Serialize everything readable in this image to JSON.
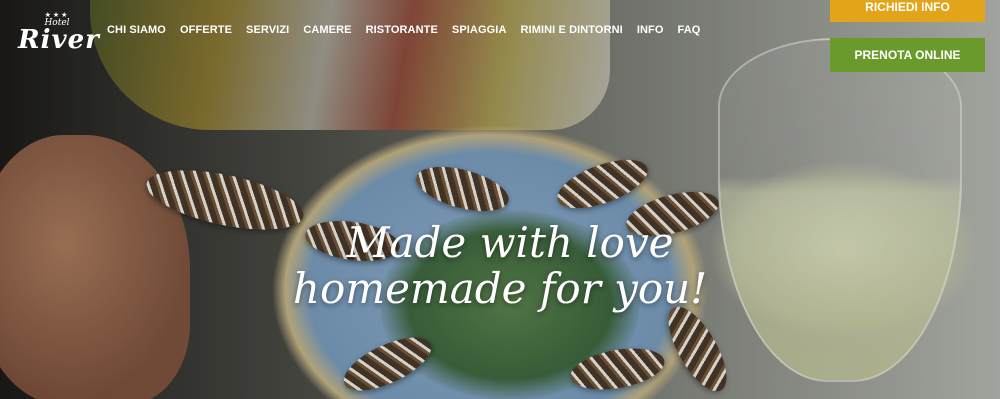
{
  "logo": {
    "stars": "★★★",
    "hotel": "Hotel",
    "name": "River"
  },
  "nav": {
    "items": [
      {
        "label": "CHI SIAMO"
      },
      {
        "label": "OFFERTE"
      },
      {
        "label": "SERVIZI"
      },
      {
        "label": "CAMERE"
      },
      {
        "label": "RISTORANTE"
      },
      {
        "label": "SPIAGGIA"
      },
      {
        "label": "RIMINI E DINTORNI"
      },
      {
        "label": "INFO"
      },
      {
        "label": "FAQ"
      }
    ]
  },
  "cta": {
    "info_label": "RICHIEDI INFO",
    "book_label": "PRENOTA ONLINE"
  },
  "hero": {
    "line1": "Made with love",
    "line2": "homemade for you!"
  },
  "colors": {
    "info": "#e2a418",
    "book": "#6b9a2c",
    "text": "#ffffff"
  }
}
